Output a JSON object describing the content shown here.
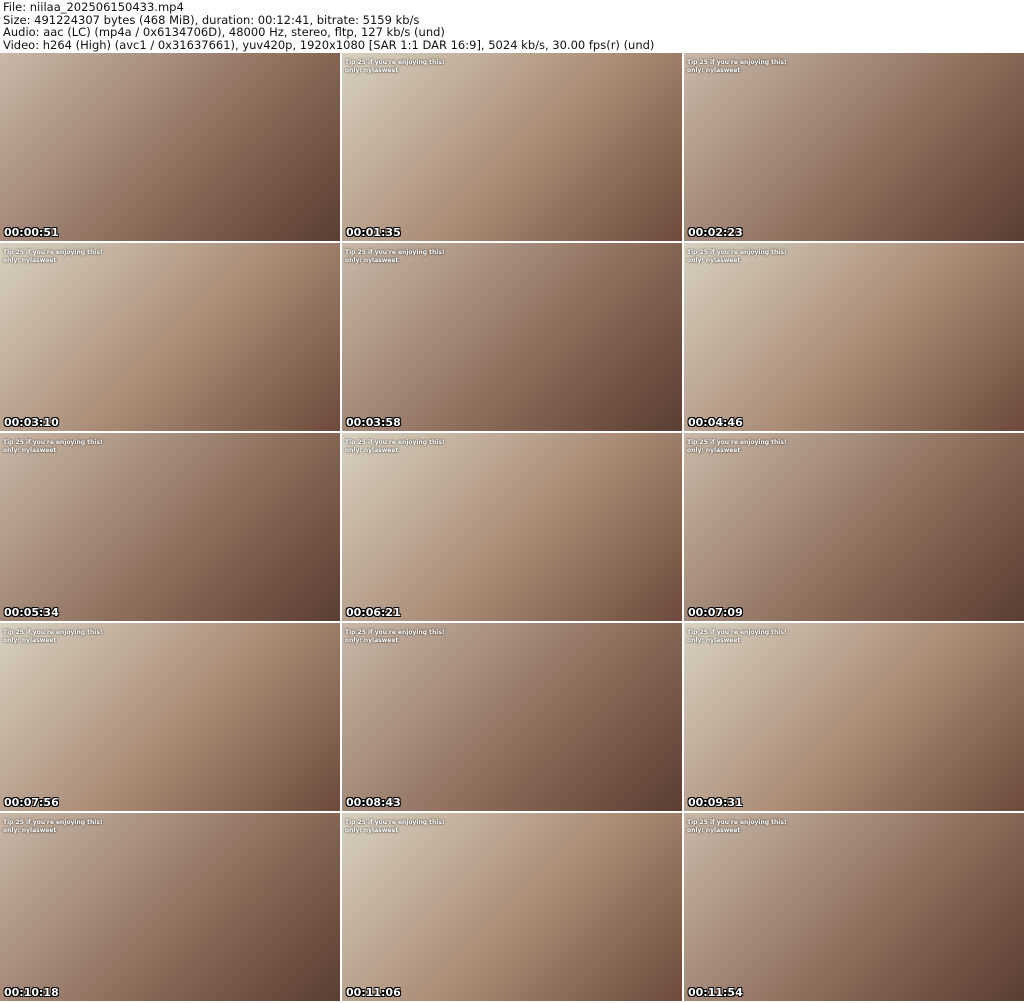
{
  "header": {
    "file": "File: niilaa_202506150433.mp4",
    "size": "Size: 491224307 bytes (468 MiB), duration: 00:12:41, bitrate: 5159 kb/s",
    "audio": "Audio: aac (LC) (mp4a / 0x6134706D), 48000 Hz, stereo, fltp, 127 kb/s (und)",
    "video": "Video: h264 (High) (avc1 / 0x31637661), yuv420p, 1920x1080 [SAR 1:1 DAR 16:9], 5024 kb/s, 30.00 fps(r) (und)"
  },
  "overlay": {
    "line1": "Tip 25 if you're enjoying this!",
    "line2": "only: nylasweet"
  },
  "thumbnails": [
    {
      "timestamp": "00:00:51"
    },
    {
      "timestamp": "00:01:35"
    },
    {
      "timestamp": "00:02:23"
    },
    {
      "timestamp": "00:03:10"
    },
    {
      "timestamp": "00:03:58"
    },
    {
      "timestamp": "00:04:46"
    },
    {
      "timestamp": "00:05:34"
    },
    {
      "timestamp": "00:06:21"
    },
    {
      "timestamp": "00:07:09"
    },
    {
      "timestamp": "00:07:56"
    },
    {
      "timestamp": "00:08:43"
    },
    {
      "timestamp": "00:09:31"
    },
    {
      "timestamp": "00:10:18"
    },
    {
      "timestamp": "00:11:06"
    },
    {
      "timestamp": "00:11:54"
    }
  ]
}
